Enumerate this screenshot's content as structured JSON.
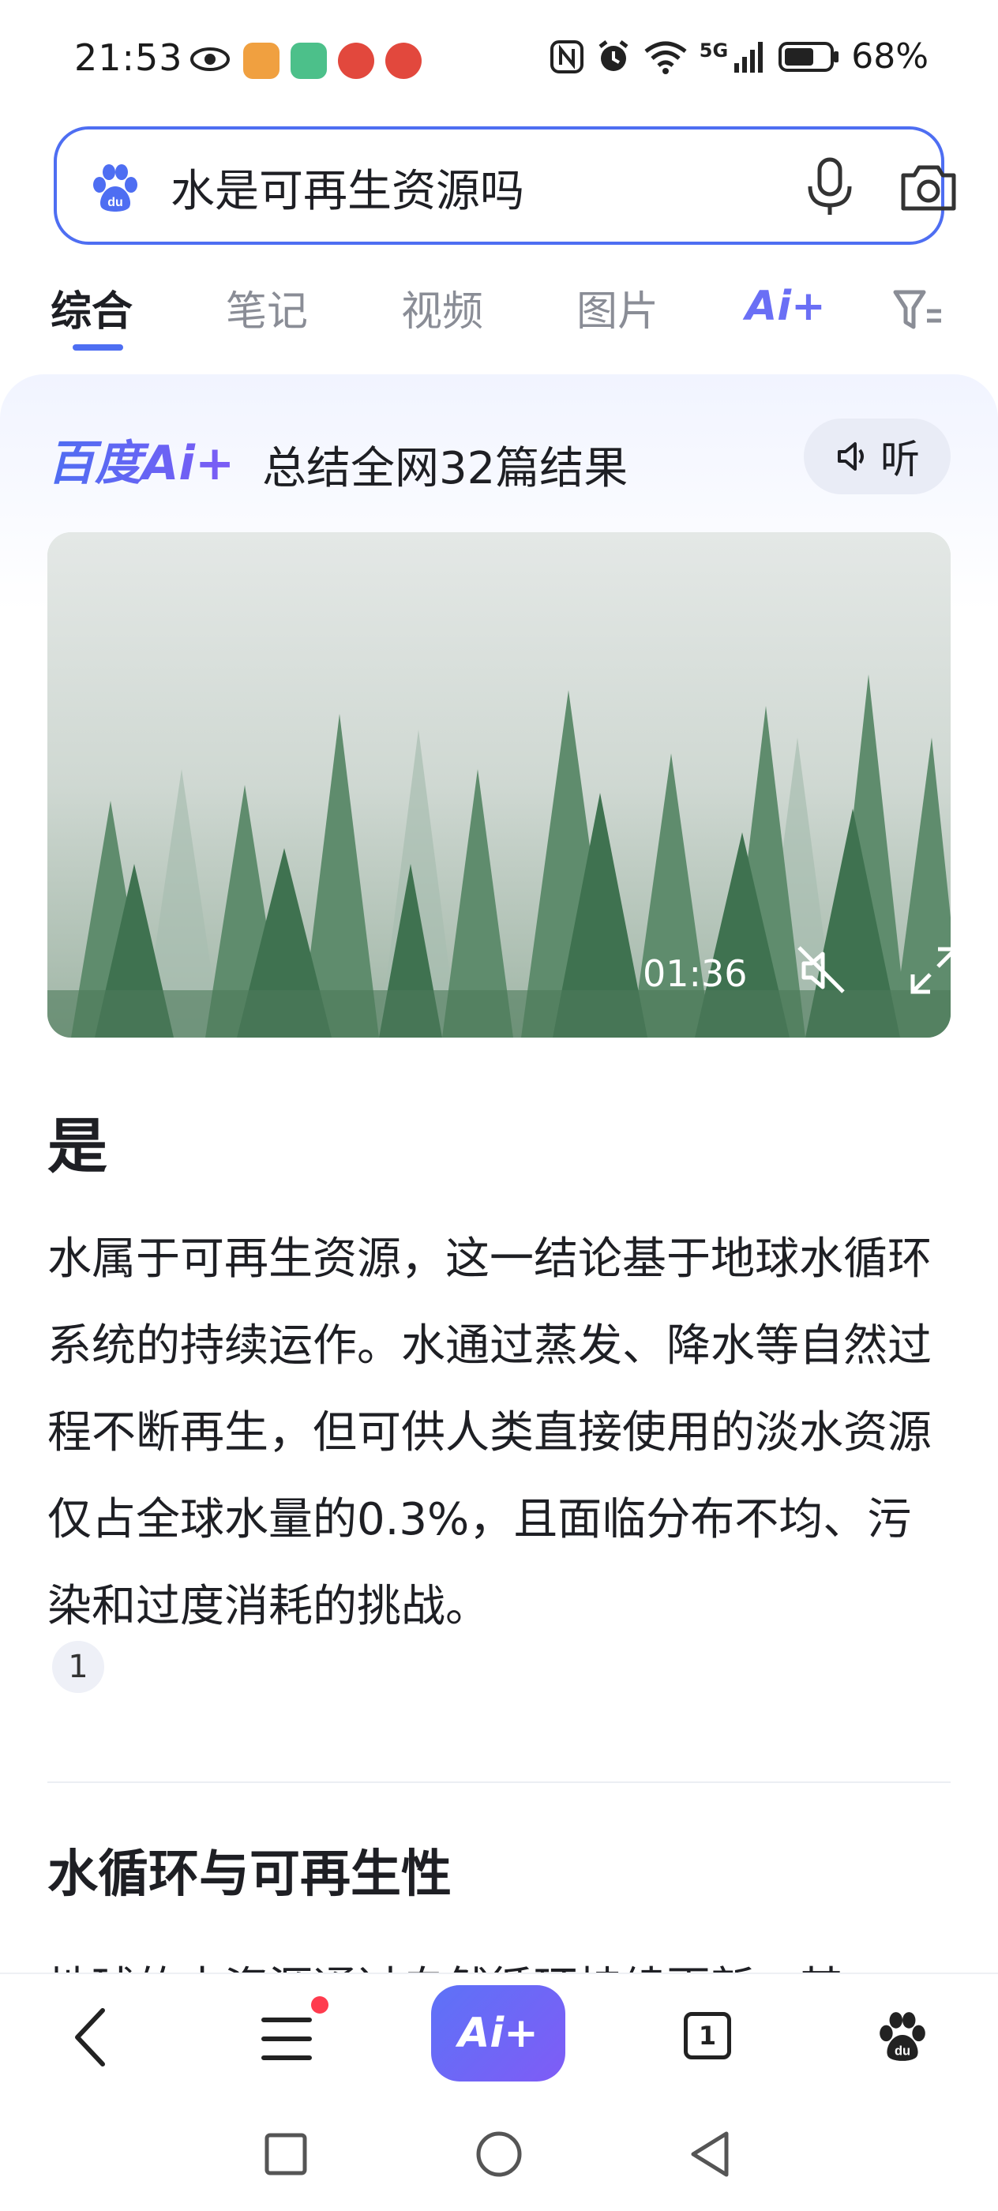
{
  "status_bar": {
    "time": "21:53",
    "network": "5G",
    "battery": "68%"
  },
  "search": {
    "query": "水是可再生资源吗"
  },
  "tabs": [
    {
      "label": "综合",
      "active": true
    },
    {
      "label": "笔记",
      "active": false
    },
    {
      "label": "视频",
      "active": false
    },
    {
      "label": "图片",
      "active": false
    }
  ],
  "ai_tab_label": "Ai+",
  "ai_card": {
    "brand": "百度Ai+",
    "summary": "总结全网32篇结果",
    "listen_label": "听",
    "video": {
      "duration": "01:36"
    },
    "headline": "是",
    "body": "水属于可再生资源，这一结论基于地球水循环系统的持续运作。水通过蒸发、降水等自然过程不断再生，但可供人类直接使用的淡水资源仅占全球水量的0.3%，且面临分布不均、污染和过度消耗的挑战。",
    "citation": "1",
    "section_heading": "水循环与可再生性",
    "clipped_text": "地球的水资源通过自然循环持续更新，其"
  },
  "toolbar": {
    "ai_label": "Ai+",
    "tab_count": "1"
  },
  "colors": {
    "accent": "#4e6ef2",
    "ai_gradient_start": "#5d72f7",
    "ai_gradient_end": "#7f5cf6",
    "notification_dot": "#ff3b4e"
  },
  "icons": [
    "eye-icon",
    "nfc-icon",
    "alarm-icon",
    "wifi-icon",
    "signal-icon",
    "battery-icon",
    "baidu-paw-icon",
    "mic-icon",
    "camera-icon",
    "filter-icon",
    "speaker-icon",
    "mute-icon",
    "fullscreen-icon",
    "back-icon",
    "menu-icon",
    "tabs-icon",
    "baidu-home-icon",
    "recent-apps-icon",
    "home-circle-icon",
    "nav-back-icon"
  ]
}
